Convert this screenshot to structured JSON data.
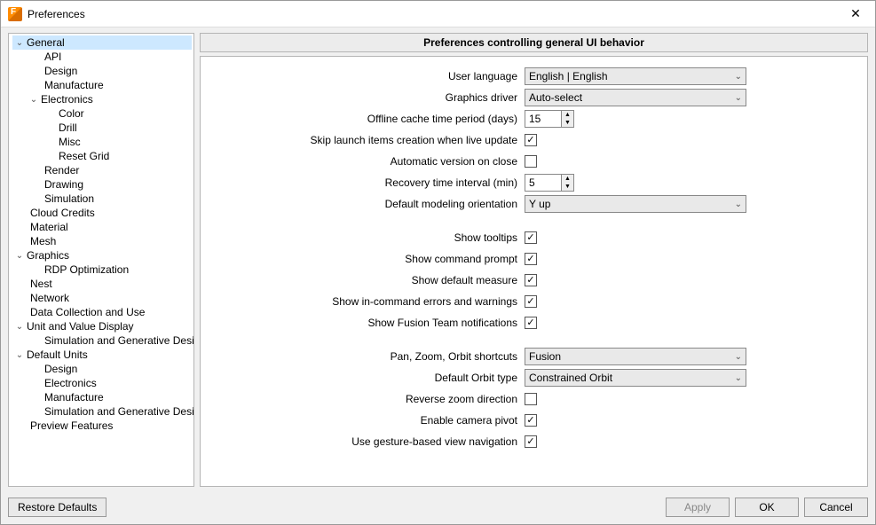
{
  "window": {
    "title": "Preferences"
  },
  "section_header": "Preferences controlling general UI behavior",
  "tree": {
    "general": "General",
    "api": "API",
    "design": "Design",
    "manufacture": "Manufacture",
    "electronics": "Electronics",
    "color": "Color",
    "drill": "Drill",
    "misc": "Misc",
    "reset_grid": "Reset Grid",
    "render": "Render",
    "drawing": "Drawing",
    "simulation": "Simulation",
    "cloud_credits": "Cloud Credits",
    "material": "Material",
    "mesh": "Mesh",
    "graphics": "Graphics",
    "rdp_optimization": "RDP Optimization",
    "nest": "Nest",
    "network": "Network",
    "data_collection": "Data Collection and Use",
    "unit_value_display": "Unit and Value Display",
    "sim_gen_design": "Simulation and Generative Design",
    "default_units": "Default Units",
    "du_design": "Design",
    "du_electronics": "Electronics",
    "du_manufacture": "Manufacture",
    "du_sim_gen": "Simulation and Generative Design",
    "preview_features": "Preview Features"
  },
  "form": {
    "user_language": {
      "label": "User language",
      "value": "English | English"
    },
    "graphics_driver": {
      "label": "Graphics driver",
      "value": "Auto-select"
    },
    "offline_cache": {
      "label": "Offline cache time period (days)",
      "value": "15"
    },
    "skip_launch": {
      "label": "Skip launch items creation when live update",
      "checked": true
    },
    "auto_version": {
      "label": "Automatic version on close",
      "checked": false
    },
    "recovery_interval": {
      "label": "Recovery time interval (min)",
      "value": "5"
    },
    "default_modeling": {
      "label": "Default modeling orientation",
      "value": "Y up"
    },
    "show_tooltips": {
      "label": "Show tooltips",
      "checked": true
    },
    "show_prompt": {
      "label": "Show command prompt",
      "checked": true
    },
    "show_measure": {
      "label": "Show default measure",
      "checked": true
    },
    "show_errors": {
      "label": "Show in-command errors and warnings",
      "checked": true
    },
    "show_fusion_team": {
      "label": "Show Fusion Team notifications",
      "checked": true
    },
    "pan_zoom": {
      "label": "Pan, Zoom, Orbit shortcuts",
      "value": "Fusion"
    },
    "orbit_type": {
      "label": "Default Orbit type",
      "value": "Constrained Orbit"
    },
    "reverse_zoom": {
      "label": "Reverse zoom direction",
      "checked": false
    },
    "camera_pivot": {
      "label": "Enable camera pivot",
      "checked": true
    },
    "gesture_nav": {
      "label": "Use gesture-based view navigation",
      "checked": true
    }
  },
  "buttons": {
    "restore": "Restore Defaults",
    "apply": "Apply",
    "ok": "OK",
    "cancel": "Cancel"
  }
}
